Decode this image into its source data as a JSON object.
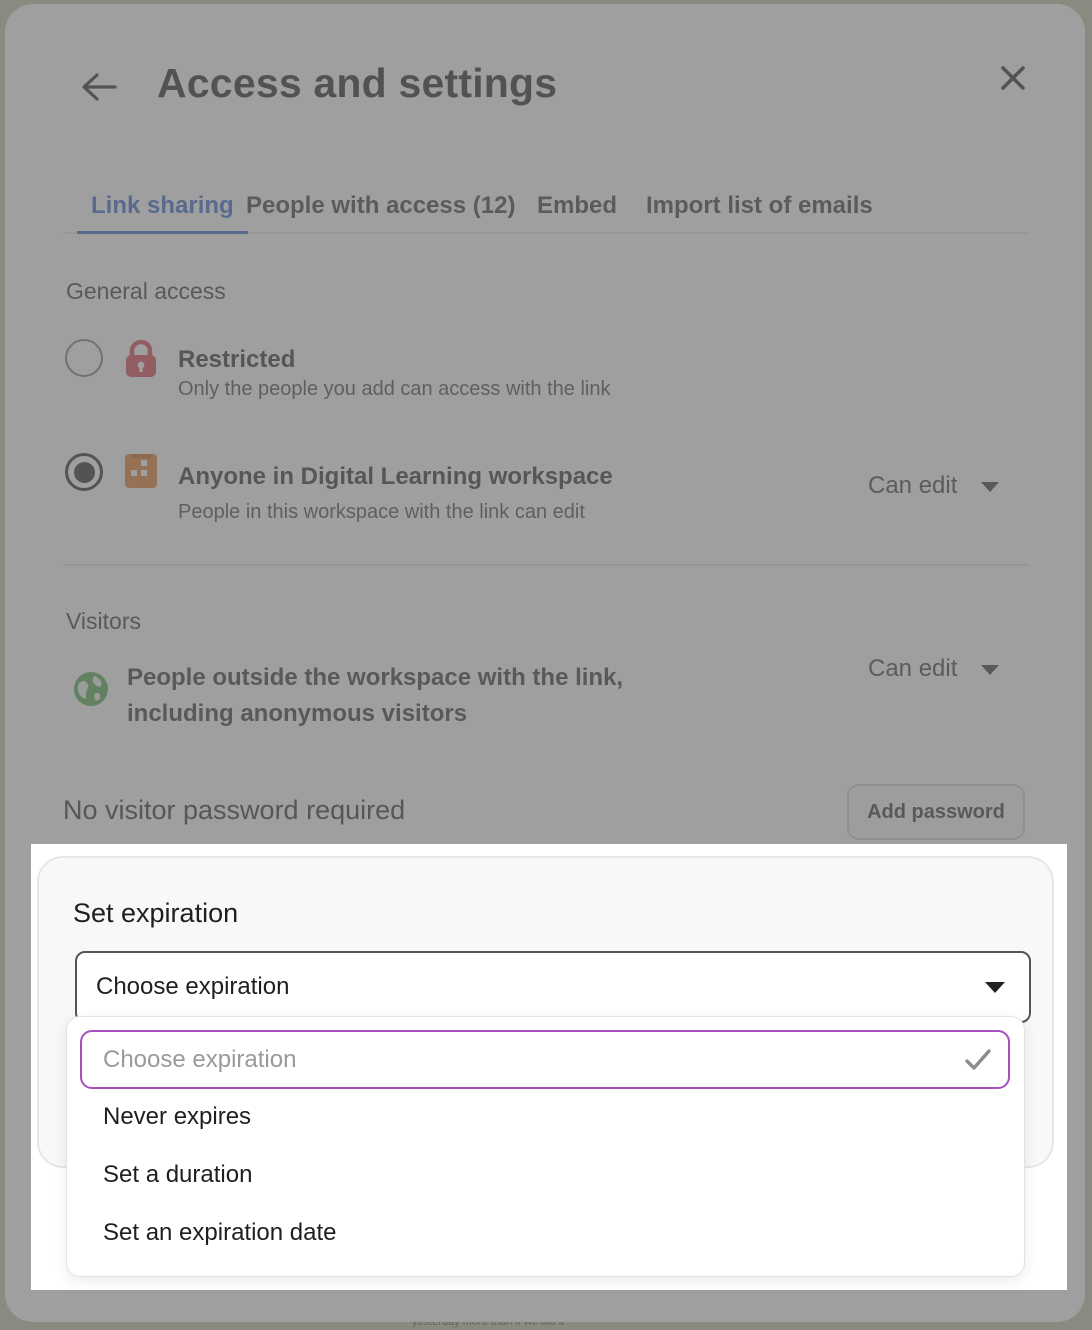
{
  "header": {
    "title": "Access and settings"
  },
  "tabs": [
    {
      "label": "Link sharing",
      "active": true
    },
    {
      "label": "People with access (12)",
      "active": false
    },
    {
      "label": "Embed",
      "active": false
    },
    {
      "label": "Import list of emails",
      "active": false
    }
  ],
  "general_access": {
    "label": "General access",
    "options": [
      {
        "title": "Restricted",
        "description": "Only the people you add can access with the link",
        "icon": "lock-icon",
        "selected": false
      },
      {
        "title": "Anyone in Digital Learning workspace",
        "description": "People in this workspace with the link can edit",
        "icon": "building-icon",
        "selected": true,
        "permission": "Can edit"
      }
    ]
  },
  "visitors": {
    "label": "Visitors",
    "description_line1": "People outside the workspace with the link,",
    "description_line2": "including anonymous visitors",
    "icon": "globe-icon",
    "permission": "Can edit"
  },
  "password": {
    "status": "No visitor password required",
    "button_label": "Add password"
  },
  "expiration": {
    "title": "Set expiration",
    "selected_value": "Choose expiration",
    "options": [
      {
        "label": "Choose expiration",
        "selected": true
      },
      {
        "label": "Never expires",
        "selected": false
      },
      {
        "label": "Set a duration",
        "selected": false
      },
      {
        "label": "Set an expiration date",
        "selected": false
      }
    ]
  },
  "background": {
    "footer_fragment": "yesterday more than if we did it"
  },
  "colors": {
    "accent": "#2f66d0",
    "lock": "#d9414e",
    "building": "#e87a28",
    "globe": "#4aa84a",
    "dropdown_highlight": "#a64fc0"
  }
}
